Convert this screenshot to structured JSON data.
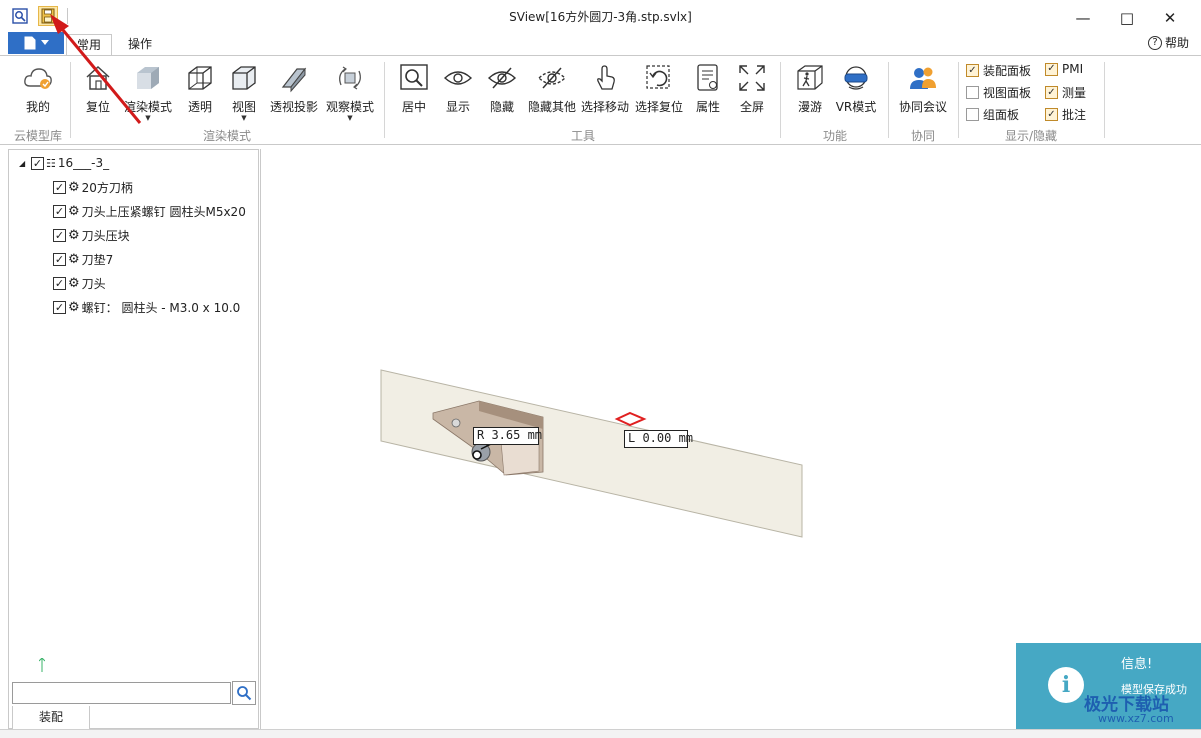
{
  "window": {
    "title": "SView[16方外圆刀-3角.stp.svlx]",
    "minimize": "—",
    "maximize": "□",
    "close": "✕"
  },
  "quick_access": {
    "icons": [
      "zoom-app-icon",
      "save-icon"
    ]
  },
  "tabs": {
    "app_menu_icon": "document-icon",
    "items": [
      "常用",
      "操作"
    ],
    "help": "帮助"
  },
  "ribbon": {
    "buttons": {
      "my": "我的",
      "reset": "复位",
      "render_mode": "渲染模式",
      "transparent": "透明",
      "view": "视图",
      "perspective": "透视投影",
      "observe_mode": "观察模式",
      "center": "居中",
      "show": "显示",
      "hide": "隐藏",
      "hide_others": "隐藏其他",
      "select_move": "选择移动",
      "select_reset": "选择复位",
      "properties": "属性",
      "fullscreen": "全屏",
      "roam": "漫游",
      "vr_mode": "VR模式",
      "meeting": "协同会议"
    },
    "groups": {
      "cloud": "云模型库",
      "render": "渲染模式",
      "tools": "工具",
      "function": "功能",
      "collab": "协同",
      "display": "显示/隐藏"
    },
    "checkboxes": [
      {
        "label": "装配面板",
        "checked": true
      },
      {
        "label": "视图面板",
        "checked": false
      },
      {
        "label": "组面板",
        "checked": false
      },
      {
        "label": "PMI",
        "checked": true
      },
      {
        "label": "测量",
        "checked": true
      },
      {
        "label": "批注",
        "checked": true
      }
    ]
  },
  "tree": {
    "root": "16___-3_",
    "children": [
      "20方刀柄",
      "刀头上压紧螺钉 圆柱头M5x20",
      "刀头压块",
      "刀垫7",
      "刀头",
      "螺钉： 圆柱头 - M3.0 x 10.0"
    ],
    "search_placeholder": "",
    "bottom_tab": "装配"
  },
  "viewport": {
    "dim_radius": "R 3.65 mm",
    "dim_length": "L 0.00 mm"
  },
  "notification": {
    "title": "信息!",
    "message": "模型保存成功",
    "icon": "info-icon"
  },
  "watermark": {
    "text": "极光下载站",
    "url": "www.xz7.com"
  },
  "colors": {
    "app_menu": "#2f6fc6",
    "save_highlight": "#fde7a6",
    "annotation_arrow": "#d11a1a",
    "notification": "#46a8c4"
  }
}
